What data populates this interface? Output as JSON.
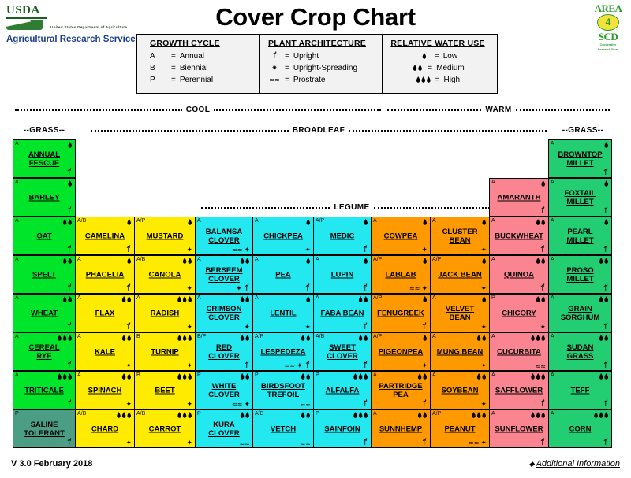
{
  "header": {
    "title": "Cover Crop Chart",
    "usda": {
      "wordmark": "USDA",
      "subtitle": "United States Department of Agriculture",
      "agency": "Agricultural Research Service"
    },
    "area_logo": {
      "top": "AREA",
      "number": "4",
      "bottom": "SCD",
      "tagline_line1": "Cooperative",
      "tagline_line2": "Research Farm"
    }
  },
  "legend": {
    "growth_cycle": {
      "title": "GROWTH CYCLE",
      "rows": [
        {
          "key": "A",
          "eq": "=",
          "label": "Annual"
        },
        {
          "key": "B",
          "eq": "=",
          "label": "Biennial"
        },
        {
          "key": "P",
          "eq": "=",
          "label": "Perennial"
        }
      ]
    },
    "plant_architecture": {
      "title": "PLANT ARCHITECTURE",
      "rows": [
        {
          "icon": "upright-icon",
          "eq": "=",
          "label": "Upright"
        },
        {
          "icon": "upright-spreading-icon",
          "eq": "=",
          "label": "Upright-Spreading"
        },
        {
          "icon": "prostrate-icon",
          "eq": "=",
          "label": "Prostrate"
        }
      ]
    },
    "relative_water_use": {
      "title": "RELATIVE WATER USE",
      "rows": [
        {
          "drops": 1,
          "eq": "=",
          "label": "Low"
        },
        {
          "drops": 2,
          "eq": "=",
          "label": "Medium"
        },
        {
          "drops": 3,
          "eq": "=",
          "label": "High"
        }
      ]
    }
  },
  "section_labels": {
    "cool": "COOL",
    "warm": "WARM",
    "grass_left": "--GRASS--",
    "grass_right": "--GRASS--",
    "broadleaf": "BROADLEAF",
    "legume": "LEGUME"
  },
  "colors": {
    "grass_cool": "#00e529",
    "grass_warm": "#23cd71",
    "saline": "#4b9e84",
    "broadleaf_cool": "#ffeb00",
    "legume_cool": "#23e8f0",
    "legume_warm": "#ff9900",
    "broadleaf_warm": "#fa8591",
    "border": "#000000"
  },
  "footer": {
    "version": "V 3.0 February 2018",
    "additional_information": "Additional Information"
  },
  "crops": [
    {
      "name": "ANNUAL FESCUE",
      "col": 0,
      "row": 0,
      "cycle": "A",
      "water": 1,
      "arch": [
        "upright"
      ],
      "group": "grass_cool"
    },
    {
      "name": "BARLEY",
      "col": 0,
      "row": 1,
      "cycle": "A",
      "water": 1,
      "arch": [
        "upright"
      ],
      "group": "grass_cool"
    },
    {
      "name": "OAT",
      "col": 0,
      "row": 2,
      "cycle": "A",
      "water": 2,
      "arch": [
        "upright"
      ],
      "group": "grass_cool"
    },
    {
      "name": "SPELT",
      "col": 0,
      "row": 3,
      "cycle": "A",
      "water": 2,
      "arch": [
        "upright"
      ],
      "group": "grass_cool"
    },
    {
      "name": "WHEAT",
      "col": 0,
      "row": 4,
      "cycle": "A",
      "water": 2,
      "arch": [
        "upright"
      ],
      "group": "grass_cool"
    },
    {
      "name": "CEREAL RYE",
      "col": 0,
      "row": 5,
      "cycle": "A",
      "water": 3,
      "arch": [
        "upright"
      ],
      "group": "grass_cool"
    },
    {
      "name": "TRITICALE",
      "col": 0,
      "row": 6,
      "cycle": "A",
      "water": 3,
      "arch": [
        "upright"
      ],
      "group": "grass_cool"
    },
    {
      "name": "SALINE TOLERANT",
      "col": 0,
      "row": 7,
      "cycle": "P",
      "water": 0,
      "arch": [
        "upright"
      ],
      "group": "saline"
    },
    {
      "name": "CAMELINA",
      "col": 1,
      "row": 2,
      "cycle": "A/B",
      "water": 1,
      "arch": [
        "upright"
      ],
      "group": "broadleaf_cool"
    },
    {
      "name": "PHACELIA",
      "col": 1,
      "row": 3,
      "cycle": "A",
      "water": 1,
      "arch": [
        "upright"
      ],
      "group": "broadleaf_cool"
    },
    {
      "name": "FLAX",
      "col": 1,
      "row": 4,
      "cycle": "A",
      "water": 2,
      "arch": [
        "upright"
      ],
      "group": "broadleaf_cool"
    },
    {
      "name": "KALE",
      "col": 1,
      "row": 5,
      "cycle": "A",
      "water": 2,
      "arch": [
        "spreading"
      ],
      "group": "broadleaf_cool"
    },
    {
      "name": "SPINACH",
      "col": 1,
      "row": 6,
      "cycle": "A",
      "water": 2,
      "arch": [
        "spreading"
      ],
      "group": "broadleaf_cool"
    },
    {
      "name": "CHARD",
      "col": 1,
      "row": 7,
      "cycle": "A/B",
      "water": 3,
      "arch": [
        "spreading"
      ],
      "group": "broadleaf_cool"
    },
    {
      "name": "MUSTARD",
      "col": 2,
      "row": 2,
      "cycle": "A/P",
      "water": 1,
      "arch": [
        "spreading"
      ],
      "group": "broadleaf_cool"
    },
    {
      "name": "CANOLA",
      "col": 2,
      "row": 3,
      "cycle": "A/B",
      "water": 2,
      "arch": [
        "spreading"
      ],
      "group": "broadleaf_cool"
    },
    {
      "name": "RADISH",
      "col": 2,
      "row": 4,
      "cycle": "A",
      "water": 3,
      "arch": [
        "spreading"
      ],
      "group": "broadleaf_cool"
    },
    {
      "name": "TURNIP",
      "col": 2,
      "row": 5,
      "cycle": "B",
      "water": 3,
      "arch": [
        "spreading"
      ],
      "group": "broadleaf_cool"
    },
    {
      "name": "BEET",
      "col": 2,
      "row": 6,
      "cycle": "B",
      "water": 3,
      "arch": [
        "spreading"
      ],
      "group": "broadleaf_cool"
    },
    {
      "name": "CARROT",
      "col": 2,
      "row": 7,
      "cycle": "A/B",
      "water": 3,
      "arch": [
        "spreading"
      ],
      "group": "broadleaf_cool"
    },
    {
      "name": "BALANSA CLOVER",
      "col": 3,
      "row": 2,
      "cycle": "A",
      "water": 0,
      "arch": [
        "prostrate",
        "spreading"
      ],
      "group": "legume_cool"
    },
    {
      "name": "BERSEEM CLOVER",
      "col": 3,
      "row": 3,
      "cycle": "A",
      "water": 2,
      "arch": [
        "spreading",
        "upright"
      ],
      "group": "legume_cool"
    },
    {
      "name": "CRIMSON CLOVER",
      "col": 3,
      "row": 4,
      "cycle": "A",
      "water": 2,
      "arch": [
        "spreading"
      ],
      "group": "legume_cool"
    },
    {
      "name": "RED CLOVER",
      "col": 3,
      "row": 5,
      "cycle": "B/P",
      "water": 2,
      "arch": [
        "upright"
      ],
      "group": "legume_cool"
    },
    {
      "name": "WHITE CLOVER",
      "col": 3,
      "row": 6,
      "cycle": "P",
      "water": 2,
      "arch": [
        "prostrate",
        "spreading"
      ],
      "group": "legume_cool"
    },
    {
      "name": "KURA CLOVER",
      "col": 3,
      "row": 7,
      "cycle": "P",
      "water": 2,
      "arch": [
        "prostrate"
      ],
      "group": "legume_cool"
    },
    {
      "name": "CHICKPEA",
      "col": 4,
      "row": 2,
      "cycle": "A",
      "water": 1,
      "arch": [
        "spreading"
      ],
      "group": "legume_cool"
    },
    {
      "name": "PEA",
      "col": 4,
      "row": 3,
      "cycle": "A",
      "water": 1,
      "arch": [
        "upright"
      ],
      "group": "legume_cool"
    },
    {
      "name": "LENTIL",
      "col": 4,
      "row": 4,
      "cycle": "A",
      "water": 1,
      "arch": [
        "spreading"
      ],
      "group": "legume_cool"
    },
    {
      "name": "LESPEDEZA",
      "col": 4,
      "row": 5,
      "cycle": "A/P",
      "water": 2,
      "arch": [
        "prostrate",
        "spreading",
        "upright"
      ],
      "group": "legume_cool"
    },
    {
      "name": "BIRDSFOOT TREFOIL",
      "col": 4,
      "row": 6,
      "cycle": "P",
      "water": 2,
      "arch": [
        "prostrate"
      ],
      "group": "legume_cool"
    },
    {
      "name": "VETCH",
      "col": 4,
      "row": 7,
      "cycle": "A/B",
      "water": 2,
      "arch": [
        "prostrate"
      ],
      "group": "legume_cool"
    },
    {
      "name": "MEDIC",
      "col": 5,
      "row": 2,
      "cycle": "A/P",
      "water": 1,
      "arch": [
        "upright"
      ],
      "group": "legume_cool"
    },
    {
      "name": "LUPIN",
      "col": 5,
      "row": 3,
      "cycle": "A",
      "water": 1,
      "arch": [
        "upright"
      ],
      "group": "legume_cool"
    },
    {
      "name": "FABA BEAN",
      "col": 5,
      "row": 4,
      "cycle": "A",
      "water": 2,
      "arch": [
        "upright"
      ],
      "group": "legume_cool"
    },
    {
      "name": "SWEET CLOVER",
      "col": 5,
      "row": 5,
      "cycle": "A/B",
      "water": 2,
      "arch": [
        "upright"
      ],
      "group": "legume_cool"
    },
    {
      "name": "ALFALFA",
      "col": 5,
      "row": 6,
      "cycle": "P",
      "water": 3,
      "arch": [
        "upright"
      ],
      "group": "legume_cool"
    },
    {
      "name": "SAINFOIN",
      "col": 5,
      "row": 7,
      "cycle": "P",
      "water": 3,
      "arch": [
        "upright"
      ],
      "group": "legume_cool"
    },
    {
      "name": "COWPEA",
      "col": 6,
      "row": 2,
      "cycle": "A",
      "water": 1,
      "arch": [
        "spreading"
      ],
      "group": "legume_warm"
    },
    {
      "name": "LABLAB",
      "col": 6,
      "row": 3,
      "cycle": "A/P",
      "water": 1,
      "arch": [
        "prostrate",
        "spreading"
      ],
      "group": "legume_warm"
    },
    {
      "name": "FENUGREEK",
      "col": 6,
      "row": 4,
      "cycle": "A/P",
      "water": 1,
      "arch": [
        "upright"
      ],
      "group": "legume_warm"
    },
    {
      "name": "PIGEONPEA",
      "col": 6,
      "row": 5,
      "cycle": "A/P",
      "water": 1,
      "arch": [
        "spreading"
      ],
      "group": "legume_warm"
    },
    {
      "name": "PARTRIDGE PEA",
      "col": 6,
      "row": 6,
      "cycle": "A",
      "water": 2,
      "arch": [
        "upright"
      ],
      "group": "legume_warm"
    },
    {
      "name": "SUNNHEMP",
      "col": 6,
      "row": 7,
      "cycle": "A",
      "water": 2,
      "arch": [
        "upright"
      ],
      "group": "legume_warm"
    },
    {
      "name": "CLUSTER BEAN",
      "col": 7,
      "row": 2,
      "cycle": "A",
      "water": 1,
      "arch": [
        "spreading"
      ],
      "group": "legume_warm"
    },
    {
      "name": "JACK BEAN",
      "col": 7,
      "row": 3,
      "cycle": "A/P",
      "water": 1,
      "arch": [
        "spreading"
      ],
      "group": "legume_warm"
    },
    {
      "name": "VELVET BEAN",
      "col": 7,
      "row": 4,
      "cycle": "A",
      "water": 1,
      "arch": [
        "spreading"
      ],
      "group": "legume_warm"
    },
    {
      "name": "MUNG BEAN",
      "col": 7,
      "row": 5,
      "cycle": "A",
      "water": 2,
      "arch": [
        "spreading"
      ],
      "group": "legume_warm"
    },
    {
      "name": "SOYBEAN",
      "col": 7,
      "row": 6,
      "cycle": "A",
      "water": 2,
      "arch": [
        "spreading"
      ],
      "group": "legume_warm"
    },
    {
      "name": "PEANUT",
      "col": 7,
      "row": 7,
      "cycle": "A/P",
      "water": 3,
      "arch": [
        "prostrate",
        "spreading"
      ],
      "group": "legume_warm"
    },
    {
      "name": "AMARANTH",
      "col": 8,
      "row": 1,
      "cycle": "A",
      "water": 1,
      "arch": [
        "upright"
      ],
      "group": "broadleaf_warm"
    },
    {
      "name": "BUCKWHEAT",
      "col": 8,
      "row": 2,
      "cycle": "A",
      "water": 2,
      "arch": [
        "upright"
      ],
      "group": "broadleaf_warm"
    },
    {
      "name": "QUINOA",
      "col": 8,
      "row": 3,
      "cycle": "A",
      "water": 2,
      "arch": [
        "upright"
      ],
      "group": "broadleaf_warm"
    },
    {
      "name": "CHICORY",
      "col": 8,
      "row": 4,
      "cycle": "P",
      "water": 2,
      "arch": [
        "spreading"
      ],
      "group": "broadleaf_warm"
    },
    {
      "name": "CUCURBITA",
      "col": 8,
      "row": 5,
      "cycle": "A",
      "water": 3,
      "arch": [
        "prostrate"
      ],
      "group": "broadleaf_warm"
    },
    {
      "name": "SAFFLOWER",
      "col": 8,
      "row": 6,
      "cycle": "A",
      "water": 3,
      "arch": [
        "upright"
      ],
      "group": "broadleaf_warm"
    },
    {
      "name": "SUNFLOWER",
      "col": 8,
      "row": 7,
      "cycle": "A",
      "water": 3,
      "arch": [
        "upright"
      ],
      "group": "broadleaf_warm"
    },
    {
      "name": "BROWNTOP MILLET",
      "col": 9,
      "row": 0,
      "cycle": "A",
      "water": 1,
      "arch": [
        "upright"
      ],
      "group": "grass_warm"
    },
    {
      "name": "FOXTAIL MILLET",
      "col": 9,
      "row": 1,
      "cycle": "A",
      "water": 1,
      "arch": [
        "upright"
      ],
      "group": "grass_warm"
    },
    {
      "name": "PEARL MILLET",
      "col": 9,
      "row": 2,
      "cycle": "A",
      "water": 1,
      "arch": [
        "upright"
      ],
      "group": "grass_warm"
    },
    {
      "name": "PROSO MILLET",
      "col": 9,
      "row": 3,
      "cycle": "A",
      "water": 2,
      "arch": [
        "upright"
      ],
      "group": "grass_warm"
    },
    {
      "name": "GRAIN SORGHUM",
      "col": 9,
      "row": 4,
      "cycle": "A",
      "water": 2,
      "arch": [
        "upright"
      ],
      "group": "grass_warm"
    },
    {
      "name": "SUDAN GRASS",
      "col": 9,
      "row": 5,
      "cycle": "A",
      "water": 2,
      "arch": [
        "upright"
      ],
      "group": "grass_warm"
    },
    {
      "name": "TEFF",
      "col": 9,
      "row": 6,
      "cycle": "A",
      "water": 2,
      "arch": [
        "upright"
      ],
      "group": "grass_warm"
    },
    {
      "name": "CORN",
      "col": 9,
      "row": 7,
      "cycle": "A",
      "water": 3,
      "arch": [
        "upright"
      ],
      "group": "grass_warm"
    }
  ]
}
